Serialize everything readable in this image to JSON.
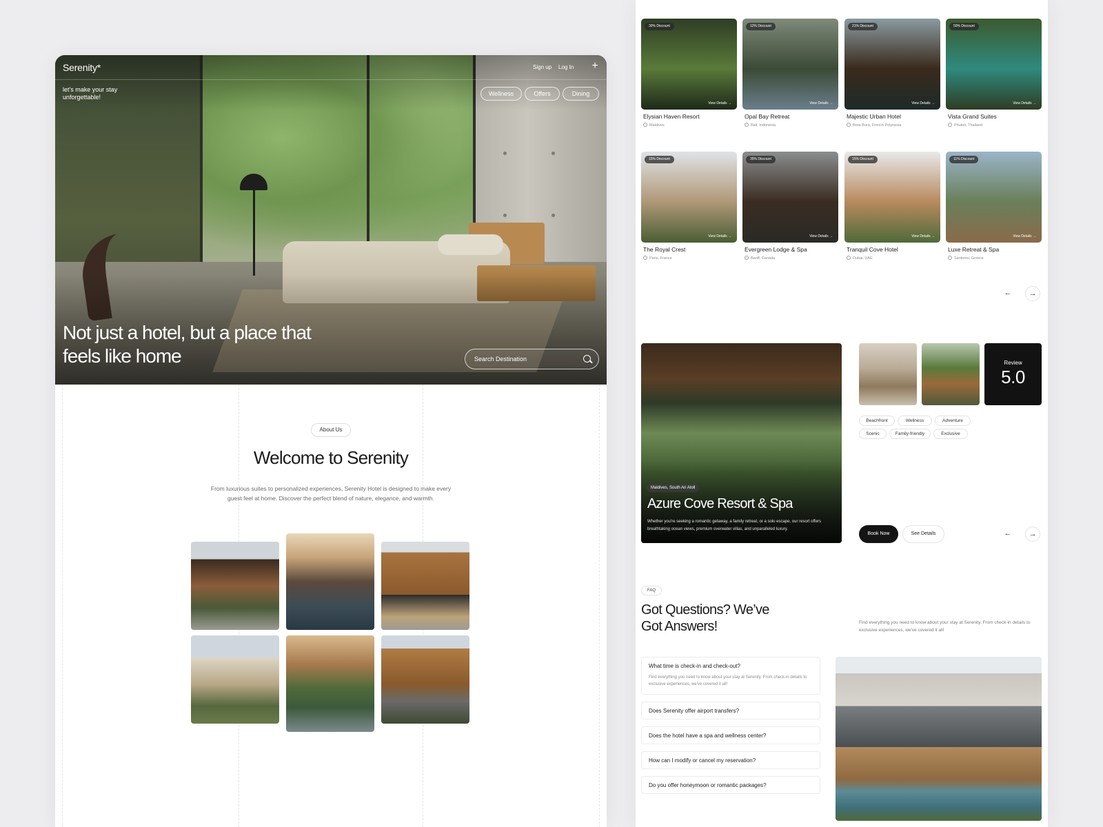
{
  "hero": {
    "brand": "Serenity*",
    "tagline": "let's make your stay unforgettable!",
    "nav": {
      "signup": "Sign up",
      "login": "Log In"
    },
    "pills": [
      "Wellness",
      "Offers",
      "Dining"
    ],
    "title": "Not just a hotel, but a place that feels like home",
    "search_placeholder": "Search Destination"
  },
  "about": {
    "pill": "About Us",
    "title": "Welcome to Serenity",
    "subtitle": "From luxurious suites to personalized experiences, Serenity Hotel is designed to make every guest feel at home. Discover the perfect blend of nature, elegance, and warmth."
  },
  "listings": {
    "view_details": "View Details →",
    "cards": [
      {
        "badge": "30% Discount",
        "name": "Elysian Haven Resort",
        "location": "Maldives",
        "colors": [
          "#2e3d24",
          "#5a7a3a",
          "#1f2a1a"
        ]
      },
      {
        "badge": "12% Discount",
        "name": "Opal Bay Retreat",
        "location": "Bali, Indonesia",
        "colors": [
          "#7f8a7a",
          "#3b4a36",
          "#6a7e8a"
        ]
      },
      {
        "badge": "21% Discount",
        "name": "Majestic Urban Hotel",
        "location": "Bora Bora, French Polynesia",
        "colors": [
          "#8a9aa0",
          "#3a2a1c",
          "#1d2a2a"
        ]
      },
      {
        "badge": "50% Discount",
        "name": "Vista Grand Suites",
        "location": "Phuket, Thailand",
        "colors": [
          "#3c5a2e",
          "#2f8a7e",
          "#2e3d24"
        ]
      },
      {
        "badge": "15% Discount",
        "name": "The Royal Crest",
        "location": "Paris, France",
        "colors": [
          "#dfe3e6",
          "#b09878",
          "#4a5e34"
        ]
      },
      {
        "badge": "35% Discount",
        "name": "Evergreen Lodge & Spa",
        "location": "Banff, Canada",
        "colors": [
          "#8a8d8f",
          "#3a2c22",
          "#2a2a26"
        ]
      },
      {
        "badge": "15% Discount",
        "name": "Tranquil Cove Hotel",
        "location": "Dubai, UAE",
        "colors": [
          "#e8e9ea",
          "#b88a5e",
          "#4f6a3a"
        ]
      },
      {
        "badge": "11% Discount",
        "name": "Luxe Retreat & Spa",
        "location": "Santorini, Greece",
        "colors": [
          "#9ab4c8",
          "#6a7f5a",
          "#8a6a4a"
        ]
      }
    ]
  },
  "carousel": {
    "prev": "←",
    "next": "→"
  },
  "featured": {
    "location": "Maldives, South Ari Atoll",
    "title": "Azure Cove Resort & Spa",
    "description": "Whether you're seeking a romantic getaway, a family retreat, or a solo escape, our resort offers breathtaking ocean views, premium overwater villas, and unparalleled luxury.",
    "review_label": "Review",
    "review_value": "5.0",
    "tags": [
      "Beachfront",
      "Wellness",
      "Adventure",
      "Scenic",
      "Family-friendly",
      "Exclusive"
    ],
    "book_now": "Book Now",
    "see_details": "See Details"
  },
  "faq": {
    "pill": "FAQ",
    "title": "Got Questions? We’ve Got Answers!",
    "subtitle": "Find everything you need to know about your stay at Serenity. From check-in details to exclusive experiences, we've covered it all!",
    "items": [
      {
        "q": "What time is check-in and check-out?",
        "a": "Find everything you need to know about your stay at Serenity. From check-in details to exclusive experiences, we've covered it all!"
      },
      {
        "q": "Does Serenity offer airport transfers?"
      },
      {
        "q": "Does the hotel have a spa and wellness center?"
      },
      {
        "q": "How can I modify or cancel my reservation?"
      },
      {
        "q": "Do you offer honeymoon or romantic packages?"
      }
    ]
  }
}
